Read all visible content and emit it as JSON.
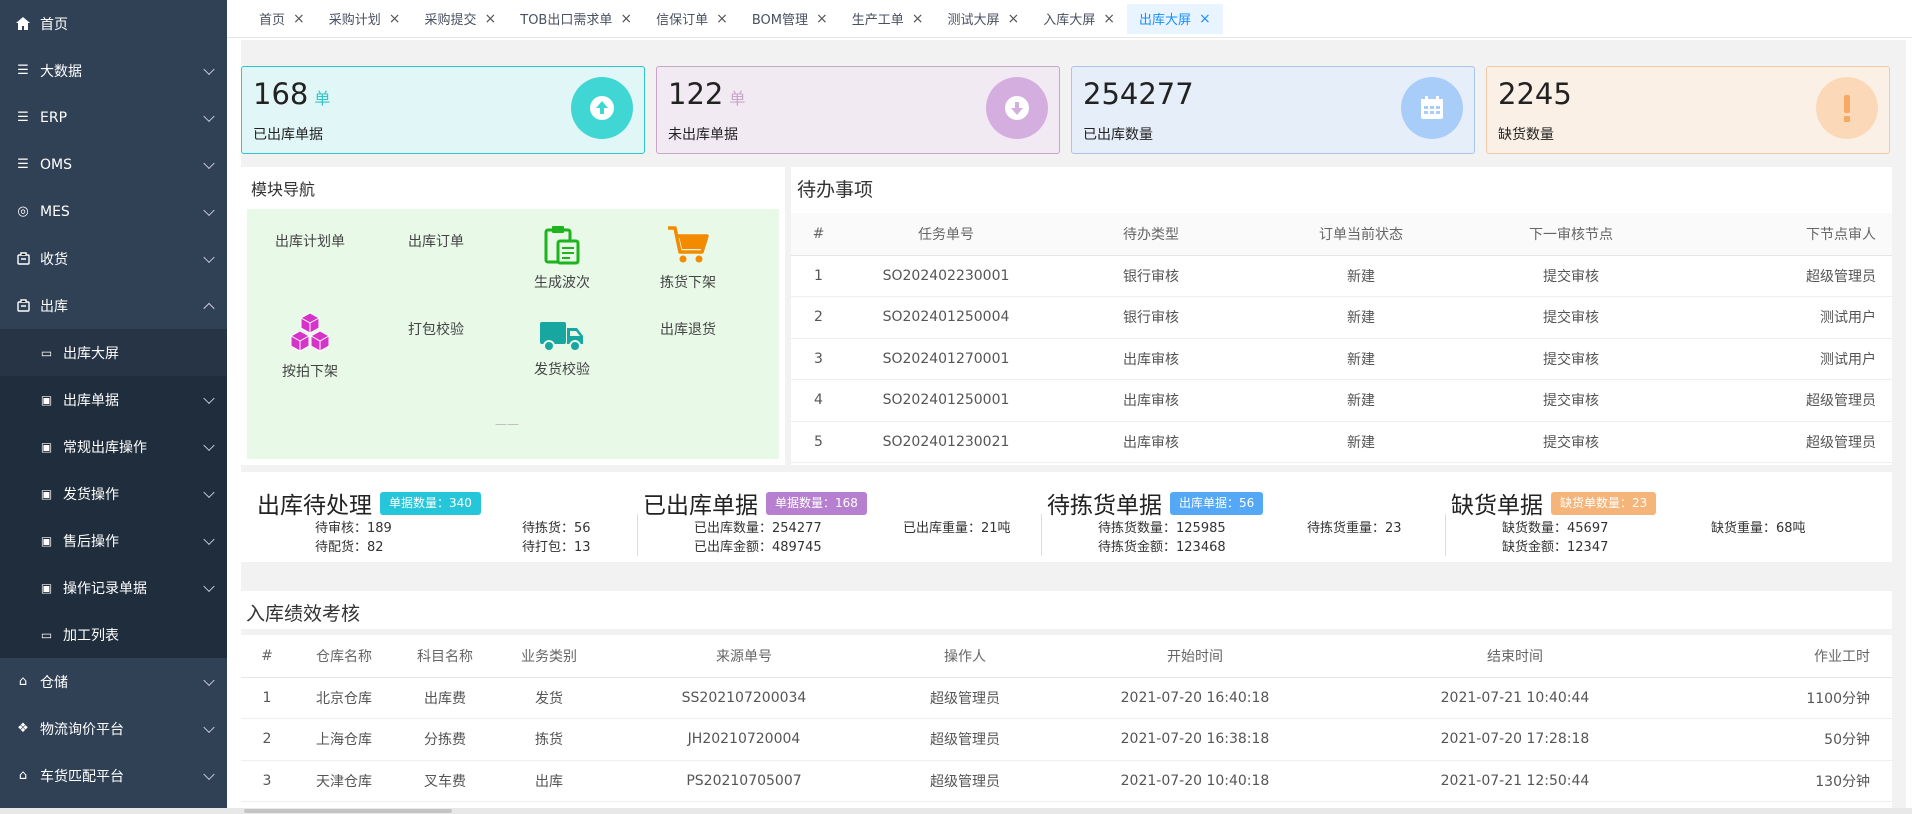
{
  "sidebar": {
    "items": [
      {
        "label": "首页",
        "icon": "home-icon"
      },
      {
        "label": "大数据",
        "icon": "list-icon"
      },
      {
        "label": "ERP",
        "icon": "list-icon"
      },
      {
        "label": "OMS",
        "icon": "list-icon"
      },
      {
        "label": "MES",
        "icon": "target-icon"
      },
      {
        "label": "收货",
        "icon": "box-icon"
      },
      {
        "label": "出库",
        "icon": "box-icon"
      }
    ],
    "sub": [
      {
        "label": "出库大屏",
        "icon": "monitor-icon"
      },
      {
        "label": "出库单据",
        "icon": "doc-icon"
      },
      {
        "label": "常规出库操作",
        "icon": "doc-icon"
      },
      {
        "label": "发货操作",
        "icon": "doc-icon"
      },
      {
        "label": "售后操作",
        "icon": "doc-icon"
      },
      {
        "label": "操作记录单据",
        "icon": "doc-icon"
      },
      {
        "label": "加工列表",
        "icon": "monitor-icon"
      }
    ],
    "bottom": [
      {
        "label": "仓储",
        "icon": "home-outline-icon"
      },
      {
        "label": "物流询价平台",
        "icon": "cubes-icon"
      },
      {
        "label": "车货匹配平台",
        "icon": "home-outline-icon"
      }
    ]
  },
  "tabs": [
    "首页",
    "采购计划",
    "采购提交",
    "TOB出口需求单",
    "信保订单",
    "BOM管理",
    "生产工单",
    "测试大屏",
    "入库大屏",
    "出库大屏"
  ],
  "active_tab": "出库大屏",
  "stats": [
    {
      "num": "168",
      "unit": "单",
      "label": "已出库单据",
      "icon": "arrow-up-icon",
      "bg": "#e1f6f6",
      "border": "#2ec7c9",
      "circle": "#3fd6d3"
    },
    {
      "num": "122",
      "unit": "单",
      "label": "未出库单据",
      "icon": "arrow-down-icon",
      "bg": "#f2eaf2",
      "border": "#c9a5c9",
      "circle": "#d5aee0"
    },
    {
      "num": "254277",
      "unit": "",
      "label": "已出库数量",
      "icon": "calendar-icon",
      "bg": "#e5eef9",
      "border": "#a9c6ea",
      "circle": "#a8cdf8"
    },
    {
      "num": "2245",
      "unit": "",
      "label": "缺货数量",
      "icon": "exclamation-icon",
      "bg": "#fbf0e6",
      "border": "#f3c9a5",
      "circle": "#fbd9b8"
    }
  ],
  "module_nav": {
    "title": "模块导航",
    "items": [
      "出库计划单",
      "出库订单",
      "生成波次",
      "拣货下架",
      "按拍下架",
      "打包校验",
      "发货校验",
      "出库退货"
    ],
    "dash": "——"
  },
  "todo": {
    "title": "待办事项",
    "headers": [
      "#",
      "任务单号",
      "待办类型",
      "订单当前状态",
      "下一审核节点",
      "下节点审人"
    ],
    "rows": [
      [
        "1",
        "SO202402230001",
        "银行审核",
        "新建",
        "提交审核",
        "超级管理员"
      ],
      [
        "2",
        "SO202401250004",
        "银行审核",
        "新建",
        "提交审核",
        "测试用户"
      ],
      [
        "3",
        "SO202401270001",
        "出库审核",
        "新建",
        "提交审核",
        "测试用户"
      ],
      [
        "4",
        "SO202401250001",
        "出库审核",
        "新建",
        "提交审核",
        "超级管理员"
      ],
      [
        "5",
        "SO202401230021",
        "出库审核",
        "新建",
        "提交审核",
        "超级管理员"
      ]
    ]
  },
  "summary": [
    {
      "title": "出库待处理",
      "badge": "单据数量：340",
      "badge_color": "#26c6da",
      "kv": [
        "待审核：189",
        "待拣货：56",
        "待配货：82",
        "待打包：13"
      ]
    },
    {
      "title": "已出库单据",
      "badge": "单据数量：168",
      "badge_color": "#b67fcf",
      "kv": [
        "已出库数量：254277",
        "已出库重量：21吨",
        "已出库金额：489745",
        ""
      ]
    },
    {
      "title": "待拣货单据",
      "badge": "出库单据：56",
      "badge_color": "#54a8f6",
      "kv": [
        "待拣货数量：125985",
        "待拣货重量：23",
        "待拣货金额：123468",
        ""
      ]
    },
    {
      "title": "缺货单据",
      "badge": "缺货单数量：23",
      "badge_color": "#f5b47a",
      "kv": [
        "缺货数量：45697",
        "缺货重量：68吨",
        "缺货金额：12347",
        ""
      ]
    }
  ],
  "perf": {
    "title": "入库绩效考核",
    "headers": [
      "#",
      "仓库名称",
      "科目名称",
      "业务类别",
      "来源单号",
      "操作人",
      "开始时间",
      "结束时间",
      "作业工时"
    ],
    "rows": [
      [
        "1",
        "北京仓库",
        "出库费",
        "发货",
        "SS202107200034",
        "超级管理员",
        "2021-07-20 16:40:18",
        "2021-07-21 10:40:44",
        "1100分钟"
      ],
      [
        "2",
        "上海仓库",
        "分拣费",
        "拣货",
        "JH20210720004",
        "超级管理员",
        "2021-07-20 16:38:18",
        "2021-07-20 17:28:18",
        "50分钟"
      ],
      [
        "3",
        "天津仓库",
        "叉车费",
        "出库",
        "PS20210705007",
        "超级管理员",
        "2021-07-20 10:40:18",
        "2021-07-21 12:50:44",
        "130分钟"
      ]
    ]
  }
}
